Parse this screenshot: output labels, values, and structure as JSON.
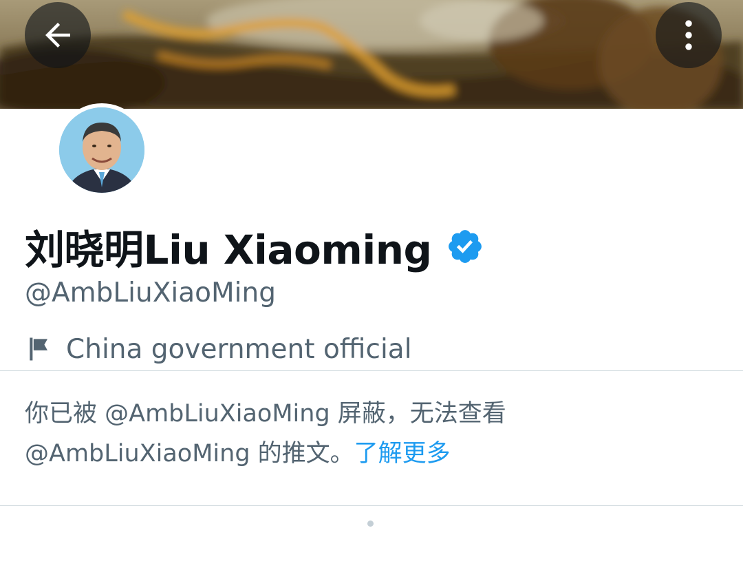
{
  "header": {
    "back_icon": "arrow-left-icon",
    "more_icon": "vertical-ellipsis-icon"
  },
  "profile": {
    "display_name": "刘晓明Liu Xiaoming",
    "verified_icon": "verified-badge-icon",
    "verified_color": "#1d9bf0",
    "handle": "@AmbLiuXiaoMing",
    "label_icon": "flag-icon",
    "label": "China government official"
  },
  "notice": {
    "line1": "你已被 @AmbLiuXiaoMing 屏蔽，无法查看",
    "line2": "@AmbLiuXiaoMing 的推文。",
    "learn_more": "了解更多",
    "link_color": "#1d9bf0"
  },
  "colors": {
    "text_primary": "#0f1419",
    "text_secondary": "#536471",
    "divider": "#cfd9de"
  }
}
